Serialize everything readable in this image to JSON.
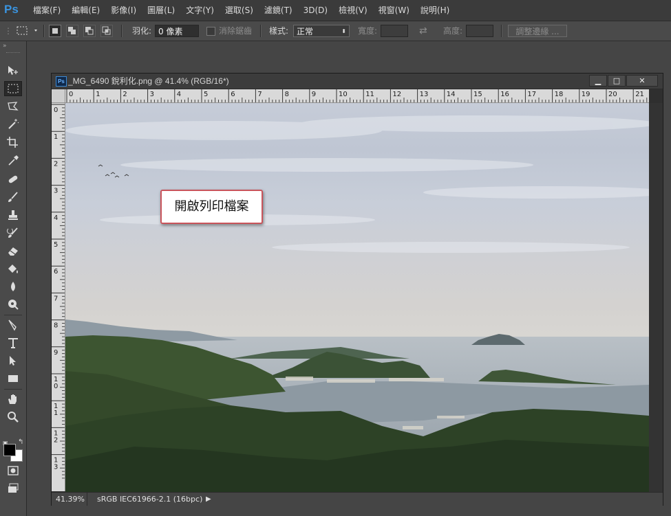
{
  "app": {
    "logo": "Ps"
  },
  "menu": [
    "檔案(F)",
    "編輯(E)",
    "影像(I)",
    "圖層(L)",
    "文字(Y)",
    "選取(S)",
    "濾鏡(T)",
    "3D(D)",
    "檢視(V)",
    "視窗(W)",
    "說明(H)"
  ],
  "options_bar": {
    "feather_label": "羽化:",
    "feather_value": "0 像素",
    "antialias_label": "消除鋸齒",
    "style_label": "樣式:",
    "style_value": "正常",
    "width_label": "寬度:",
    "height_label": "高度:",
    "refine_edge_button": "調整邊緣 ..."
  },
  "document": {
    "icon_label": "Ps",
    "title": "_MG_6490 銳利化.png @ 41.4% (RGB/16*)",
    "window_buttons": {
      "minimize": "▁",
      "maximize": "□",
      "close": "✕"
    },
    "ruler_h": [
      "0",
      "1",
      "2",
      "3",
      "4",
      "5",
      "6",
      "7",
      "8",
      "9",
      "10",
      "11",
      "12",
      "13",
      "14",
      "15",
      "16",
      "17",
      "18",
      "19",
      "20",
      "21"
    ],
    "ruler_v": [
      "0",
      "1",
      "2",
      "3",
      "4",
      "5",
      "6",
      "7",
      "8",
      "9",
      "10",
      "11",
      "12",
      "13"
    ]
  },
  "status": {
    "zoom": "41.39%",
    "profile": "sRGB IEC61966-2.1 (16bpc)",
    "arrow": "▶"
  },
  "callout": {
    "text": "開啟列印檔案"
  },
  "tools": [
    "move-tool-icon",
    "marquee-tool-icon",
    "lasso-tool-icon",
    "magic-wand-tool-icon",
    "crop-tool-icon",
    "eyedropper-tool-icon",
    "healing-brush-tool-icon",
    "brush-tool-icon",
    "clone-stamp-tool-icon",
    "history-brush-tool-icon",
    "eraser-tool-icon",
    "paint-bucket-tool-icon",
    "blur-tool-icon",
    "dodge-tool-icon",
    "pen-tool-icon",
    "type-tool-icon",
    "path-selection-tool-icon",
    "rectangle-tool-icon",
    "hand-tool-icon",
    "zoom-tool-icon"
  ],
  "colors": {
    "foreground": "#000000",
    "background": "#ffffff",
    "ps_blue": "#3a94e0",
    "callout_border": "#c9545b"
  }
}
